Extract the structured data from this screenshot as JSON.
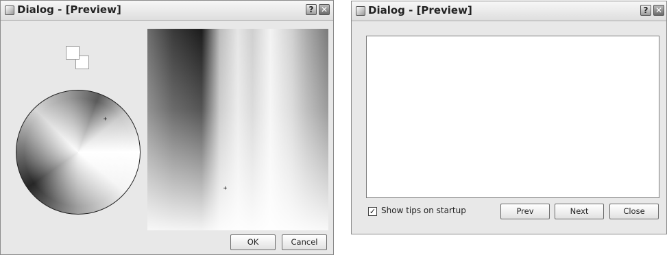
{
  "dialog1": {
    "title": "Dialog - [Preview]",
    "help_label": "?",
    "close_label": "✕",
    "ok_label": "OK",
    "cancel_label": "Cancel"
  },
  "dialog2": {
    "title": "Dialog - [Preview]",
    "help_label": "?",
    "close_label": "✕",
    "show_tips_label": "Show tips on startup",
    "show_tips_checked": true,
    "prev_label": "Prev",
    "next_label": "Next",
    "close_button_label": "Close"
  },
  "crosshair_glyph": "+",
  "checkmark_glyph": "✓",
  "icons": [
    "app-icon",
    "help-icon",
    "close-icon",
    "crosshair-icon"
  ]
}
